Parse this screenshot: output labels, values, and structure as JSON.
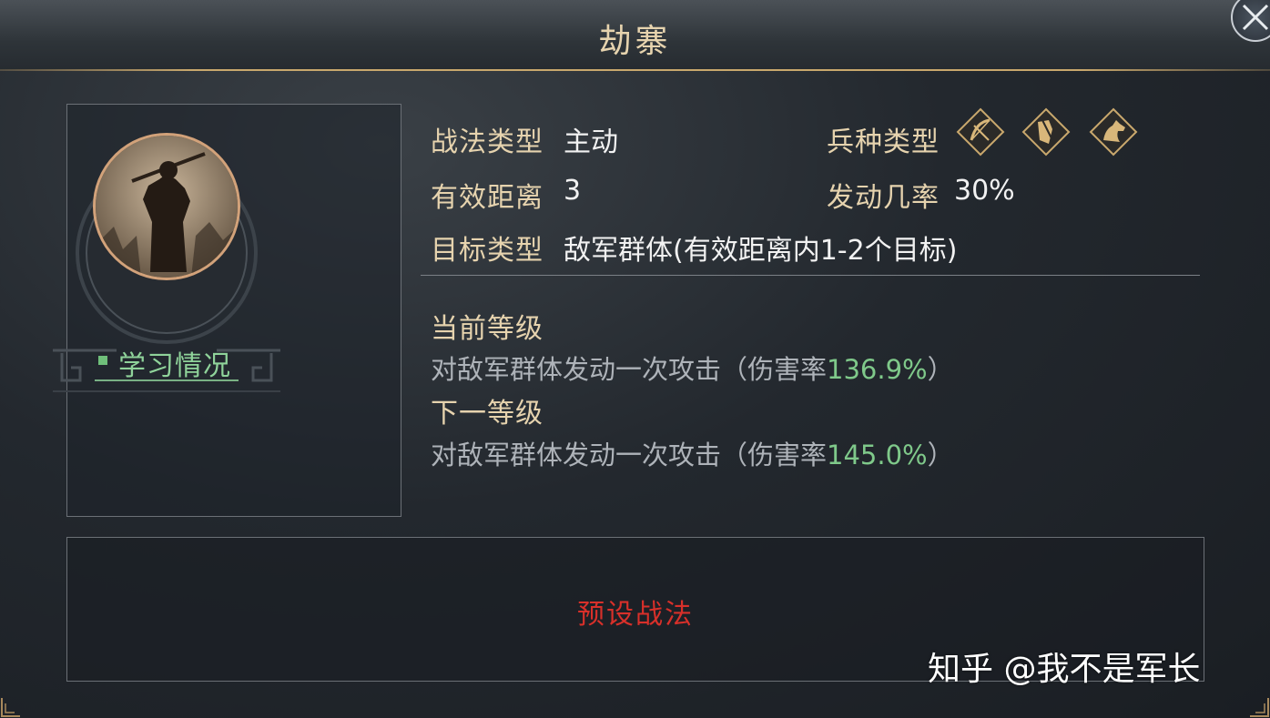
{
  "title": "劫寨",
  "skill_info": {
    "type_label": "战法类型",
    "type_value": "主动",
    "range_label": "有效距离",
    "range_value": "3",
    "target_label": "目标类型",
    "target_value": "敌军群体(有效距离内1-2个目标)",
    "troop_label": "兵种类型",
    "troop_icons": [
      "bow-icon",
      "shield-icon",
      "horse-icon"
    ],
    "chance_label": "发动几率",
    "chance_value": "30%"
  },
  "levels": {
    "current_label": "当前等级",
    "current_desc": "对敌军群体发动一次攻击（伤害率",
    "current_rate": "136.9%",
    "current_close": "）",
    "next_label": "下一等级",
    "next_desc": "对敌军群体发动一次攻击（伤害率",
    "next_rate": "145.0%",
    "next_close": "）"
  },
  "study": {
    "label": "学习情况"
  },
  "preset": {
    "label": "预设战法"
  },
  "watermark": "知乎 @我不是军长",
  "colors": {
    "gold": "#e6d3ae",
    "green": "#7fc98a",
    "red": "#d8302a",
    "desc": "#aeb3b9"
  }
}
